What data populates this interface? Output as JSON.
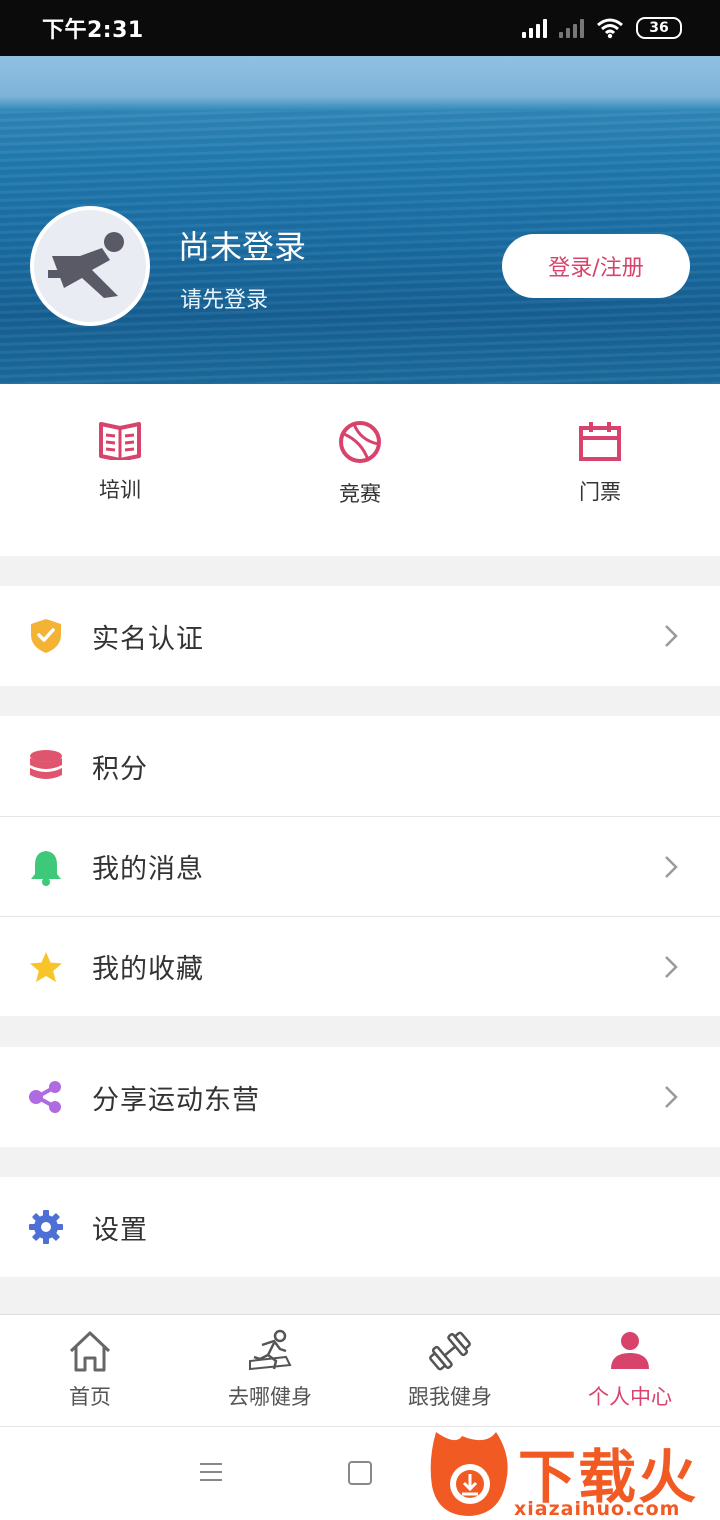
{
  "status_bar": {
    "time": "下午2:31",
    "battery": "36"
  },
  "profile": {
    "name": "尚未登录",
    "subtitle": "请先登录",
    "login_button": "登录/注册"
  },
  "quick_links": [
    {
      "label": "培训",
      "icon": "book-icon"
    },
    {
      "label": "竞赛",
      "icon": "basketball-icon"
    },
    {
      "label": "门票",
      "icon": "calendar-icon"
    }
  ],
  "menu": {
    "verify": "实名认证",
    "points": "积分",
    "messages": "我的消息",
    "favorites": "我的收藏",
    "share": "分享运动东营",
    "settings": "设置"
  },
  "tabs": [
    {
      "label": "首页",
      "icon": "home-icon"
    },
    {
      "label": "去哪健身",
      "icon": "runner-icon"
    },
    {
      "label": "跟我健身",
      "icon": "dumbbell-icon"
    },
    {
      "label": "个人中心",
      "icon": "person-icon"
    }
  ],
  "colors": {
    "accent": "#d8436c",
    "banner": "#1a6da3"
  },
  "watermark": {
    "text": "下载火",
    "url": "xiazaihuo.com"
  }
}
